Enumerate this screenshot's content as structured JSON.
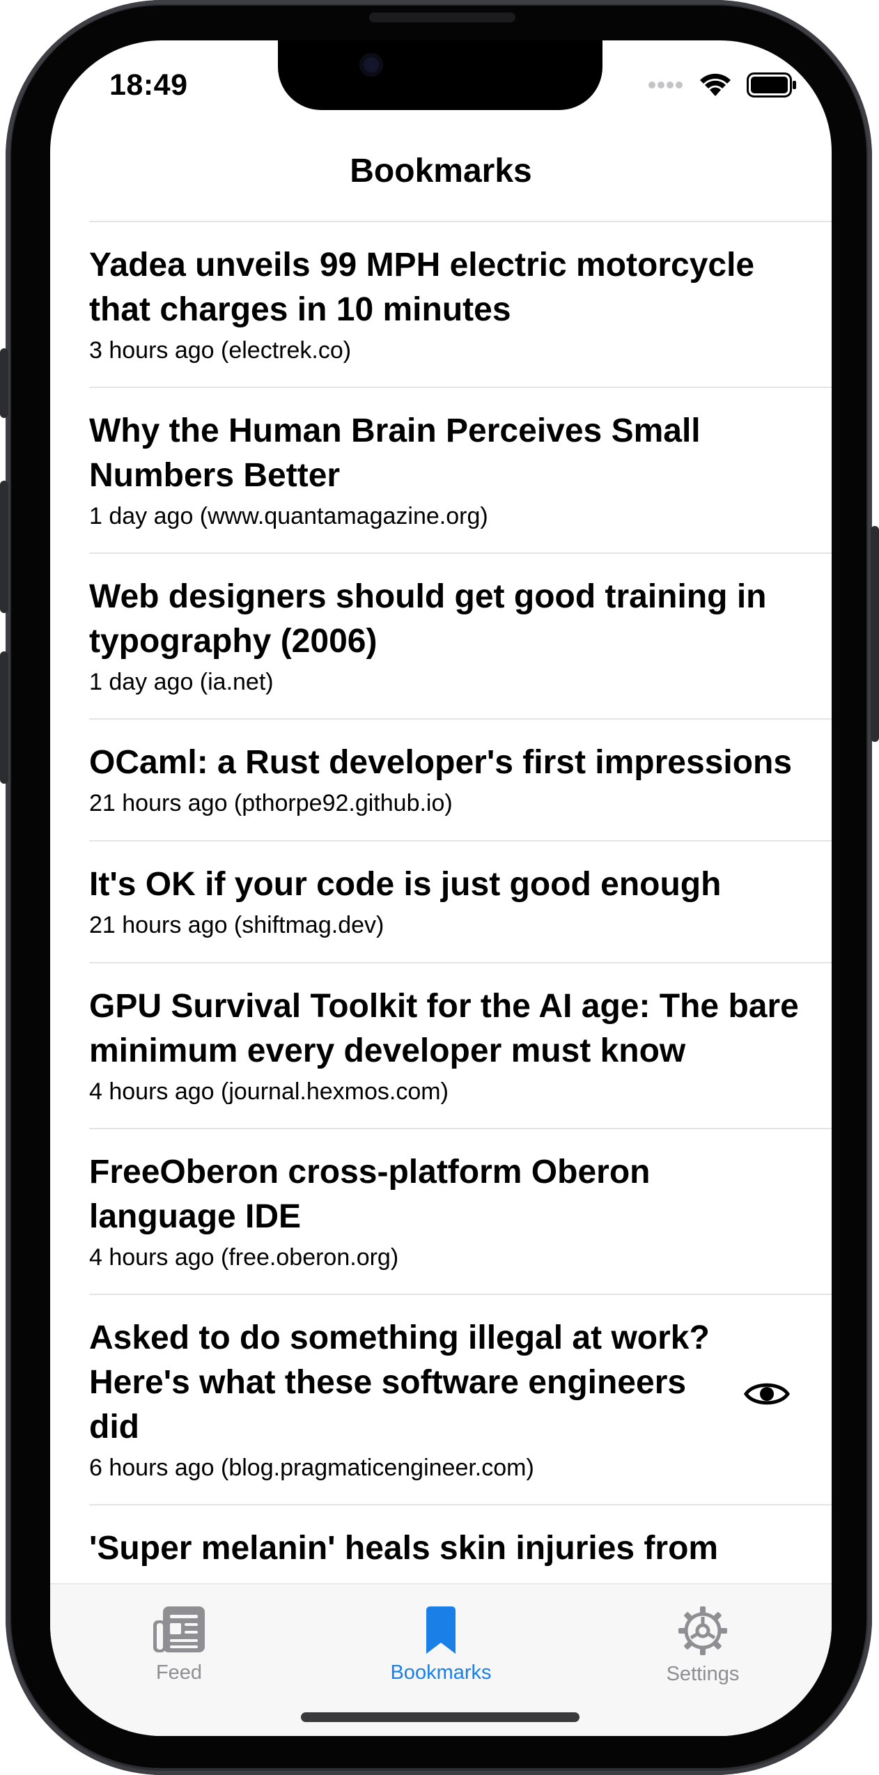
{
  "status": {
    "time": "18:49"
  },
  "nav": {
    "title": "Bookmarks"
  },
  "articles": [
    {
      "title": "Yadea unveils 99 MPH electric motorcycle that charges in 10 minutes",
      "meta": "3 hours ago (electrek.co)"
    },
    {
      "title": "Why the Human Brain Perceives Small Numbers Better",
      "meta": "1 day ago (www.quantamagazine.org)"
    },
    {
      "title": "Web designers should get good training in typography (2006)",
      "meta": "1 day ago (ia.net)"
    },
    {
      "title": "OCaml: a Rust developer's first impressions",
      "meta": "21 hours ago (pthorpe92.github.io)"
    },
    {
      "title": "It's OK if your code is just good enough",
      "meta": "21 hours ago (shiftmag.dev)"
    },
    {
      "title": "GPU Survival Toolkit for the AI age: The bare minimum every developer must know",
      "meta": "4 hours ago (journal.hexmos.com)"
    },
    {
      "title": "FreeOberon cross-platform Oberon language IDE",
      "meta": "4 hours ago (free.oberon.org)"
    },
    {
      "title": "Asked to do something illegal at work? Here's what these software engineers did",
      "meta": "6 hours ago (blog.pragmaticengineer.com)",
      "icon": "eye-icon"
    },
    {
      "title": "'Super melanin' heals skin injuries from",
      "meta": ""
    }
  ],
  "tabs": [
    {
      "label": "Feed",
      "icon": "newspaper-icon",
      "active": false
    },
    {
      "label": "Bookmarks",
      "icon": "bookmark-icon",
      "active": true
    },
    {
      "label": "Settings",
      "icon": "gear-icon",
      "active": false
    }
  ],
  "colors": {
    "accent": "#1a7fe6",
    "inactive": "#8e8e93"
  }
}
